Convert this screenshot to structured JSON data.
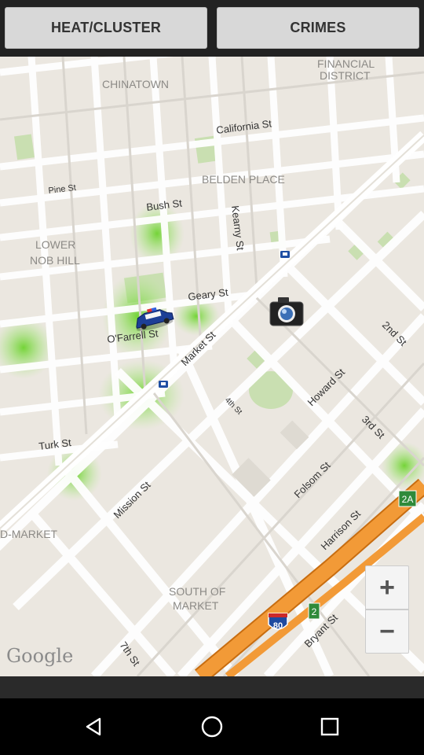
{
  "tabs": {
    "heat_cluster": "HEAT/CLUSTER",
    "crimes": "CRIMES"
  },
  "map": {
    "labels": {
      "chinatown": "CHINATOWN",
      "financial_district_1": "FINANCIAL",
      "financial_district_2": "DISTRICT",
      "belden_place": "BELDEN PLACE",
      "lower_nob_hill_1": "LOWER",
      "lower_nob_hill_2": "NOB HILL",
      "south_of_market_1": "SOUTH OF",
      "south_of_market_2": "MARKET",
      "mid_market": "D-MARKET"
    },
    "streets": {
      "california": "California St",
      "pine": "Pine St",
      "bush": "Bush St",
      "kearny": "Kearny St",
      "geary": "Geary St",
      "ofarrell": "O'Farrell St",
      "market": "Market St",
      "second": "2nd St",
      "howard": "Howard St",
      "fourth": "4th St",
      "third": "3rd St",
      "turk": "Turk St",
      "mission": "Mission St",
      "folsom": "Folsom St",
      "harrison": "Harrison St",
      "bryant": "Bryant St",
      "seventh": "7th St"
    },
    "shields": {
      "i80": "80",
      "exit2": "2",
      "exit2a": "2A"
    },
    "attribution": "Google",
    "markers": {
      "police_car": "police-car-icon",
      "camera": "camera-icon"
    }
  },
  "zoom": {
    "in_label": "+",
    "out_label": "−"
  },
  "colors": {
    "heat": "#6fd12a",
    "freeway": "#f08c25",
    "park": "#c9dfb1"
  }
}
